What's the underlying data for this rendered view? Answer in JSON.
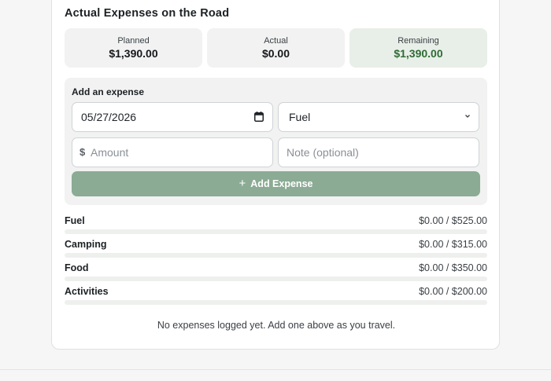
{
  "section_title": "Actual Expenses on the Road",
  "summary": {
    "planned": {
      "label": "Planned",
      "value": "$1,390.00"
    },
    "actual": {
      "label": "Actual",
      "value": "$0.00"
    },
    "remaining": {
      "label": "Remaining",
      "value": "$1,390.00"
    }
  },
  "form": {
    "title": "Add an expense",
    "date_value": "05/27/2026",
    "category_value": "Fuel",
    "currency_symbol": "$",
    "amount_placeholder": "Amount",
    "note_placeholder": "Note (optional)",
    "submit_label": "Add Expense"
  },
  "categories": [
    {
      "name": "Fuel",
      "amount": "$0.00 / $525.00",
      "progress": 0
    },
    {
      "name": "Camping",
      "amount": "$0.00 / $315.00",
      "progress": 0
    },
    {
      "name": "Food",
      "amount": "$0.00 / $350.00",
      "progress": 0
    },
    {
      "name": "Activities",
      "amount": "$0.00 / $200.00",
      "progress": 0
    }
  ],
  "empty_message": "No expenses logged yet. Add one above as you travel.",
  "colors": {
    "accent": "#8bab94",
    "remaining_text": "#2f6b35"
  }
}
